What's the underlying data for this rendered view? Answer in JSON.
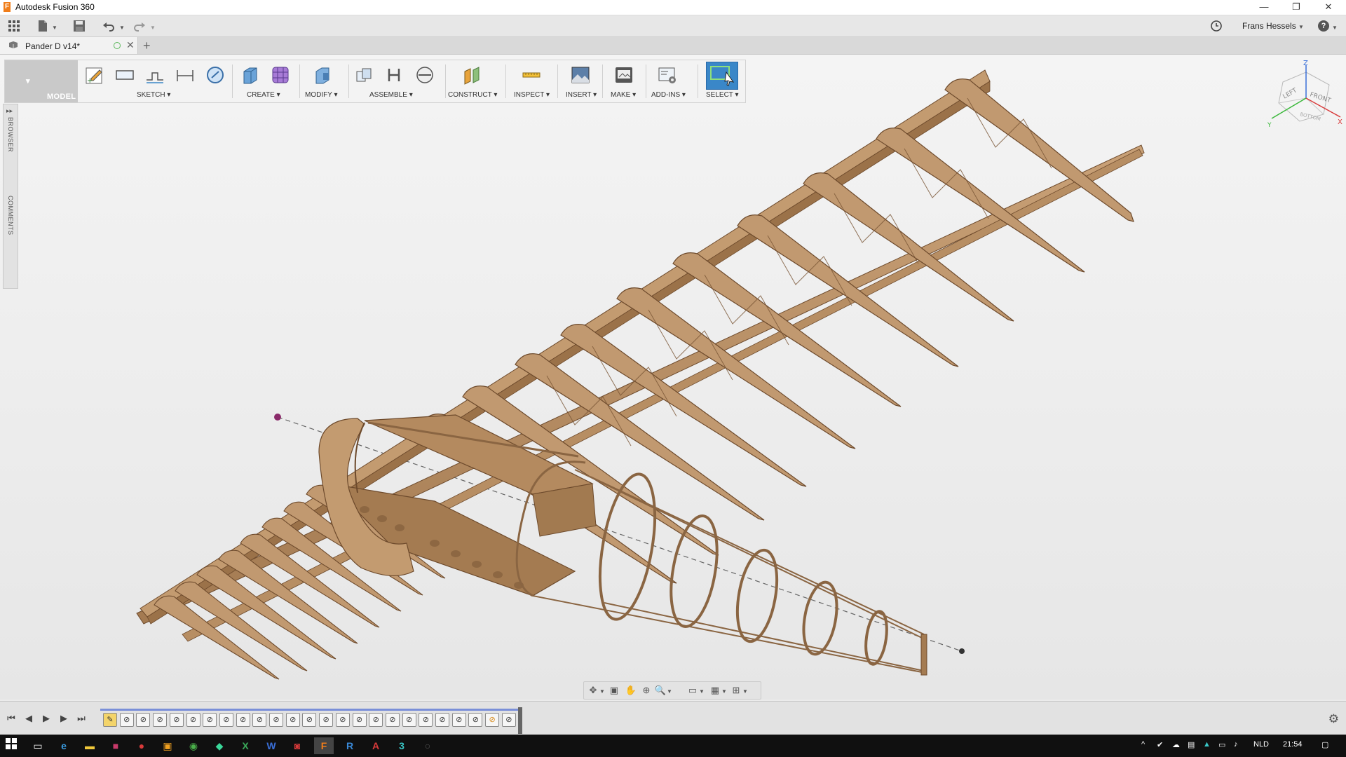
{
  "window": {
    "title": "Autodesk Fusion 360",
    "logo_letter": "F"
  },
  "window_controls": {
    "minimize": "—",
    "restore": "❐",
    "close": "✕"
  },
  "app_toolbar": {
    "grid_icon": "grid-icon",
    "file_icon": "file-icon",
    "save_icon": "save-icon",
    "undo_icon": "undo-icon",
    "redo_icon": "redo-icon",
    "clock_icon": "clock-icon",
    "user_name": "Frans Hessels",
    "help_icon": "help-icon",
    "help_label": "?"
  },
  "tabs": [
    {
      "label": "Pander D v14*",
      "active": true
    }
  ],
  "ribbon": {
    "workspace": "MODEL",
    "groups": [
      {
        "label": "SKETCH"
      },
      {
        "label": "CREATE"
      },
      {
        "label": "MODIFY"
      },
      {
        "label": "ASSEMBLE"
      },
      {
        "label": "CONSTRUCT"
      },
      {
        "label": "INSPECT"
      },
      {
        "label": "INSERT"
      },
      {
        "label": "MAKE"
      },
      {
        "label": "ADD-INS"
      },
      {
        "label": "SELECT"
      }
    ]
  },
  "side_panel": {
    "browser": "BROWSER",
    "comments": "COMMENTS"
  },
  "viewcube": {
    "z": "Z",
    "x": "X",
    "y": "Y",
    "front": "FRONT",
    "left": "LEFT",
    "bottom": "BOTTOM"
  },
  "timeline": {
    "feature_count": 25
  },
  "taskbar": {
    "language": "NLD",
    "time": "21:54"
  },
  "colors": {
    "wood": "#b98d63",
    "wood_dark": "#7a5636",
    "select_blue": "#3a87c8",
    "accent_orange": "#f07d1a",
    "taskbar": "#101010"
  }
}
